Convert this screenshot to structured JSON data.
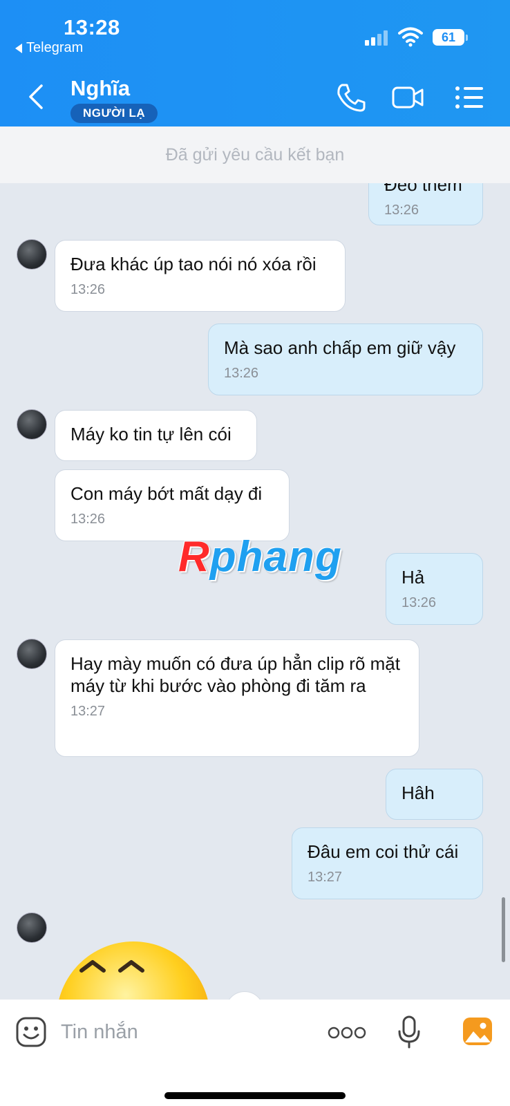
{
  "status_bar": {
    "time": "13:28",
    "back_app": "Telegram",
    "battery": "61"
  },
  "header": {
    "contact_name": "Nghĩa",
    "badge": "NGƯỜI LẠ"
  },
  "friend_request": {
    "text": "Đã gửi yêu cầu kết bạn"
  },
  "messages": [
    {
      "side": "out",
      "text": "Đéo thêm",
      "time": "13:26"
    },
    {
      "side": "in",
      "text": "Đưa khác úp tao nói nó xóa rồi",
      "time": "13:26"
    },
    {
      "side": "out",
      "text": "Mà sao anh chấp em giữ vậy",
      "time": "13:26"
    },
    {
      "side": "in",
      "text": "Máy ko tin tự lên cói",
      "time": ""
    },
    {
      "side": "in",
      "text": "Con máy bớt mất dạy đi",
      "time": "13:26"
    },
    {
      "side": "out",
      "text": "Hả",
      "time": "13:26"
    },
    {
      "side": "in",
      "text": "Hay mày muốn có đưa úp hẳn clip rõ mặt máy từ khi bước vào phòng đi tăm ra",
      "time": "13:27"
    },
    {
      "side": "out",
      "text": "Hâh",
      "time": ""
    },
    {
      "side": "out",
      "text": "Đâu em coi thử cái",
      "time": "13:27"
    }
  ],
  "watermark": {
    "first_letter": "R",
    "rest": "phang"
  },
  "input": {
    "placeholder": "Tin nhắn"
  },
  "icons": [
    "chevron-left-icon",
    "phone-icon",
    "video-icon",
    "list-menu-icon",
    "sticker-icon",
    "more-dots-icon",
    "microphone-icon",
    "image-icon"
  ],
  "colors": {
    "header": "#1d8ff5",
    "bubble_out": "#d8eefb",
    "bubble_in": "#ffffff",
    "chat_bg": "#e3e8ef"
  }
}
